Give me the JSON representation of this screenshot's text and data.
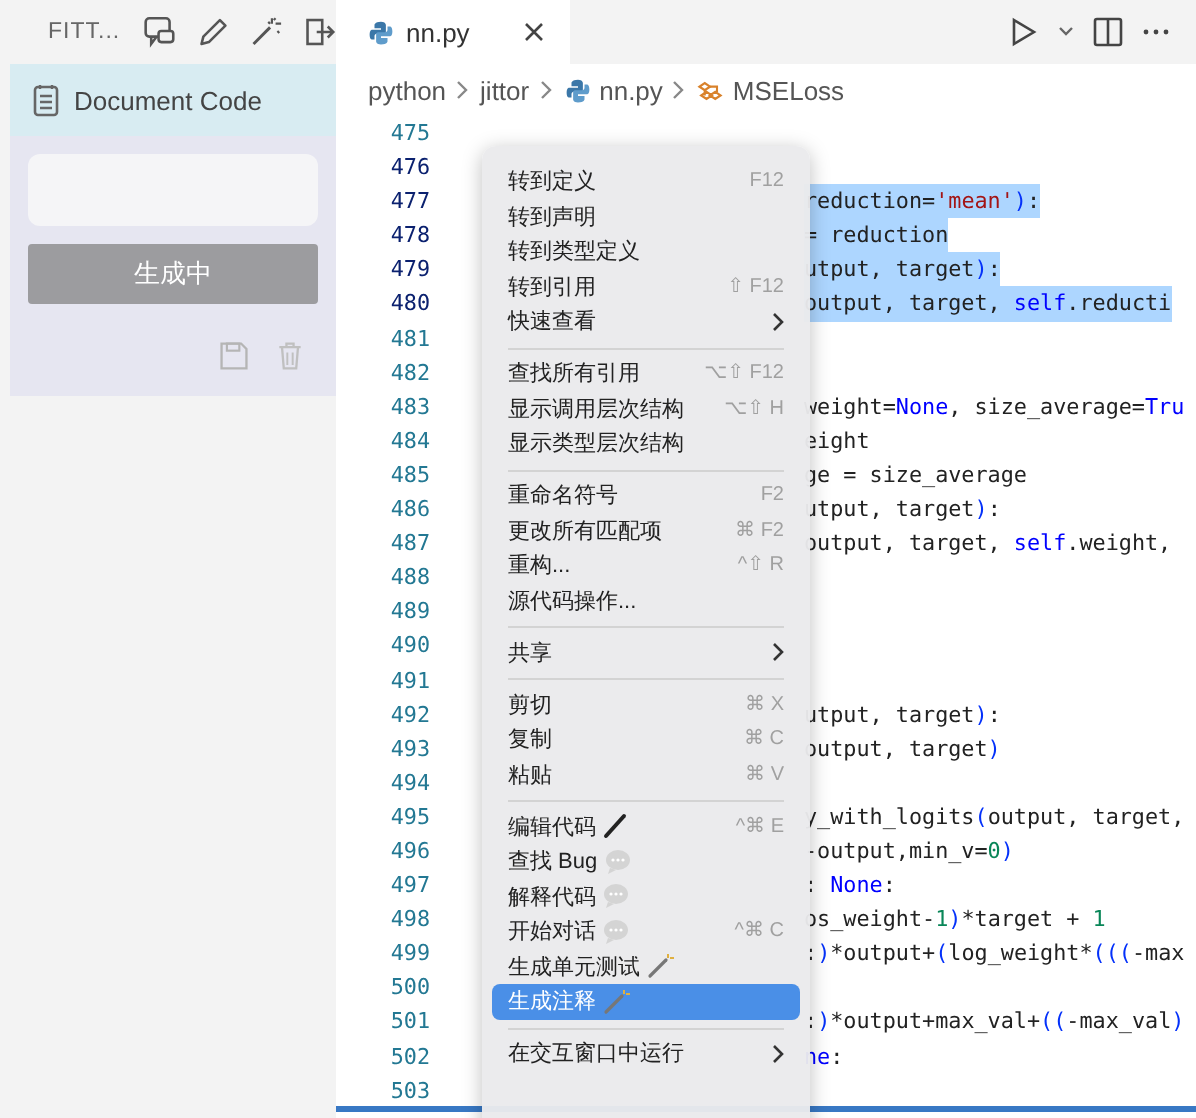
{
  "sidebar": {
    "title": "FITT...",
    "panel_title": "Document Code",
    "button": {
      "label": "生成中"
    }
  },
  "editor": {
    "tabs": [
      {
        "label": "nn.py",
        "selected": true
      }
    ],
    "breadcrumbs": [
      {
        "label": "python",
        "kind": "folder"
      },
      {
        "label": "jittor",
        "kind": "folder"
      },
      {
        "label": "nn.py",
        "kind": "file"
      },
      {
        "label": "MSELoss",
        "kind": "class"
      }
    ],
    "lines": [
      {
        "number": "475",
        "selected": false
      },
      {
        "number": "476",
        "selected": true
      },
      {
        "number": "477",
        "selected": true,
        "tokens": [
          {
            "kind": "plain",
            "text": "reduction="
          },
          {
            "kind": "string",
            "text": "'mean'"
          },
          {
            "kind": "bracket",
            "text": ")"
          },
          {
            "kind": "plain",
            "text": ":"
          }
        ]
      },
      {
        "number": "478",
        "selected": true,
        "tokens": [
          {
            "kind": "plain",
            "text": "= reduction"
          }
        ]
      },
      {
        "number": "479",
        "selected": true,
        "tokens": [
          {
            "kind": "plain",
            "text": "utput, target"
          },
          {
            "kind": "bracket",
            "text": ")"
          },
          {
            "kind": "plain",
            "text": ":"
          }
        ]
      },
      {
        "number": "480",
        "selected": true,
        "tokens": [
          {
            "kind": "plain",
            "text": "output, target, "
          },
          {
            "kind": "keyword",
            "text": "self"
          },
          {
            "kind": "plain",
            "text": ".reducti"
          }
        ]
      },
      {
        "number": "481",
        "selected": false
      },
      {
        "number": "482",
        "selected": false
      },
      {
        "number": "483",
        "selected": false,
        "tokens": [
          {
            "kind": "plain",
            "text": "weight="
          },
          {
            "kind": "keyword",
            "text": "None"
          },
          {
            "kind": "plain",
            "text": ", size_average="
          },
          {
            "kind": "keyword",
            "text": "Tru"
          }
        ]
      },
      {
        "number": "484",
        "selected": false,
        "tokens": [
          {
            "kind": "plain",
            "text": "eight"
          }
        ]
      },
      {
        "number": "485",
        "selected": false,
        "tokens": [
          {
            "kind": "plain",
            "text": "ge = size_average"
          }
        ]
      },
      {
        "number": "486",
        "selected": false,
        "tokens": [
          {
            "kind": "plain",
            "text": "utput, target"
          },
          {
            "kind": "bracket",
            "text": ")"
          },
          {
            "kind": "plain",
            "text": ":"
          }
        ]
      },
      {
        "number": "487",
        "selected": false,
        "tokens": [
          {
            "kind": "plain",
            "text": "output, target, "
          },
          {
            "kind": "keyword",
            "text": "self"
          },
          {
            "kind": "plain",
            "text": ".weight,"
          }
        ]
      },
      {
        "number": "488",
        "selected": false
      },
      {
        "number": "489",
        "selected": false
      },
      {
        "number": "490",
        "selected": false
      },
      {
        "number": "491",
        "selected": false
      },
      {
        "number": "492",
        "selected": false,
        "tokens": [
          {
            "kind": "plain",
            "text": "utput, target"
          },
          {
            "kind": "bracket",
            "text": ")"
          },
          {
            "kind": "plain",
            "text": ":"
          }
        ]
      },
      {
        "number": "493",
        "selected": false,
        "tokens": [
          {
            "kind": "plain",
            "text": "output, target"
          },
          {
            "kind": "bracket",
            "text": ")"
          }
        ]
      },
      {
        "number": "494",
        "selected": false
      },
      {
        "number": "495",
        "selected": false,
        "tokens": [
          {
            "kind": "plain",
            "text": "y_with_logits"
          },
          {
            "kind": "bracket",
            "text": "("
          },
          {
            "kind": "plain",
            "text": "output, target,"
          }
        ]
      },
      {
        "number": "496",
        "selected": false,
        "tokens": [
          {
            "kind": "plain",
            "text": "-output,min_v="
          },
          {
            "kind": "number",
            "text": "0"
          },
          {
            "kind": "bracket",
            "text": ")"
          }
        ]
      },
      {
        "number": "497",
        "selected": false,
        "tokens": [
          {
            "kind": "plain",
            "text": ": "
          },
          {
            "kind": "keyword",
            "text": "None"
          },
          {
            "kind": "plain",
            "text": ":"
          }
        ]
      },
      {
        "number": "498",
        "selected": false,
        "tokens": [
          {
            "kind": "plain",
            "text": "os_weight-"
          },
          {
            "kind": "number",
            "text": "1"
          },
          {
            "kind": "bracket",
            "text": ")"
          },
          {
            "kind": "plain",
            "text": "*target + "
          },
          {
            "kind": "number",
            "text": "1"
          }
        ]
      },
      {
        "number": "499",
        "selected": false,
        "tokens": [
          {
            "kind": "plain",
            "text": ":"
          },
          {
            "kind": "bracket",
            "text": ")"
          },
          {
            "kind": "plain",
            "text": "*output+"
          },
          {
            "kind": "bracket",
            "text": "("
          },
          {
            "kind": "plain",
            "text": "log_weight*"
          },
          {
            "kind": "bracket",
            "text": "((("
          },
          {
            "kind": "plain",
            "text": "-max"
          }
        ]
      },
      {
        "number": "500",
        "selected": false
      },
      {
        "number": "501",
        "selected": false,
        "tokens": [
          {
            "kind": "plain",
            "text": ":"
          },
          {
            "kind": "bracket",
            "text": ")"
          },
          {
            "kind": "plain",
            "text": "*output+max_val+"
          },
          {
            "kind": "bracket",
            "text": "(("
          },
          {
            "kind": "plain",
            "text": "-max_val"
          },
          {
            "kind": "bracket",
            "text": ")"
          }
        ]
      },
      {
        "number": "502",
        "selected": false,
        "tokens": [
          {
            "kind": "keyword",
            "text": "ne"
          },
          {
            "kind": "plain",
            "text": ":"
          }
        ]
      },
      {
        "number": "503",
        "selected": false
      }
    ]
  },
  "context_menu": {
    "items": [
      {
        "kind": "item",
        "label": "转到定义",
        "shortcut": "F12",
        "submenu": false,
        "selected": false
      },
      {
        "kind": "item",
        "label": "转到声明",
        "submenu": false,
        "selected": false
      },
      {
        "kind": "item",
        "label": "转到类型定义",
        "submenu": false,
        "selected": false
      },
      {
        "kind": "item",
        "label": "转到引用",
        "shortcut": "⇧ F12",
        "submenu": false,
        "selected": false
      },
      {
        "kind": "item",
        "label": "快速查看",
        "submenu": true,
        "selected": false
      },
      {
        "kind": "separator"
      },
      {
        "kind": "item",
        "label": "查找所有引用",
        "shortcut": "⌥⇧ F12",
        "submenu": false,
        "selected": false
      },
      {
        "kind": "item",
        "label": "显示调用层次结构",
        "shortcut": "⌥⇧ H",
        "submenu": false,
        "selected": false
      },
      {
        "kind": "item",
        "label": "显示类型层次结构",
        "submenu": false,
        "selected": false
      },
      {
        "kind": "separator"
      },
      {
        "kind": "item",
        "label": "重命名符号",
        "shortcut": "F2",
        "submenu": false,
        "selected": false
      },
      {
        "kind": "item",
        "label": "更改所有匹配项",
        "shortcut": "⌘ F2",
        "submenu": false,
        "selected": false
      },
      {
        "kind": "item",
        "label": "重构...",
        "shortcut": "^⇧ R",
        "submenu": false,
        "selected": false
      },
      {
        "kind": "item",
        "label": "源代码操作...",
        "submenu": false,
        "selected": false
      },
      {
        "kind": "separator"
      },
      {
        "kind": "item",
        "label": "共享",
        "submenu": true,
        "selected": false
      },
      {
        "kind": "separator"
      },
      {
        "kind": "item",
        "label": "剪切",
        "shortcut": "⌘ X",
        "submenu": false,
        "selected": false
      },
      {
        "kind": "item",
        "label": "复制",
        "shortcut": "⌘ C",
        "submenu": false,
        "selected": false
      },
      {
        "kind": "item",
        "label": "粘贴",
        "shortcut": "⌘ V",
        "submenu": false,
        "selected": false
      },
      {
        "kind": "separator"
      },
      {
        "kind": "edit",
        "label": "编辑代码",
        "shortcut": "^⌘ E",
        "submenu": false,
        "selected": false
      },
      {
        "kind": "chat",
        "label": "查找 Bug",
        "submenu": false,
        "selected": false
      },
      {
        "kind": "chat",
        "label": "解释代码",
        "submenu": false,
        "selected": false
      },
      {
        "kind": "chat",
        "label": "开始对话",
        "shortcut": "^⌘ C",
        "submenu": false,
        "selected": false
      },
      {
        "kind": "generate",
        "label": "生成单元测试",
        "submenu": false,
        "selected": false
      },
      {
        "kind": "generate",
        "label": "生成注释",
        "submenu": false,
        "selected": true
      },
      {
        "kind": "separator"
      },
      {
        "kind": "item",
        "label": "在交互窗口中运行",
        "submenu": true,
        "selected": false
      }
    ]
  }
}
